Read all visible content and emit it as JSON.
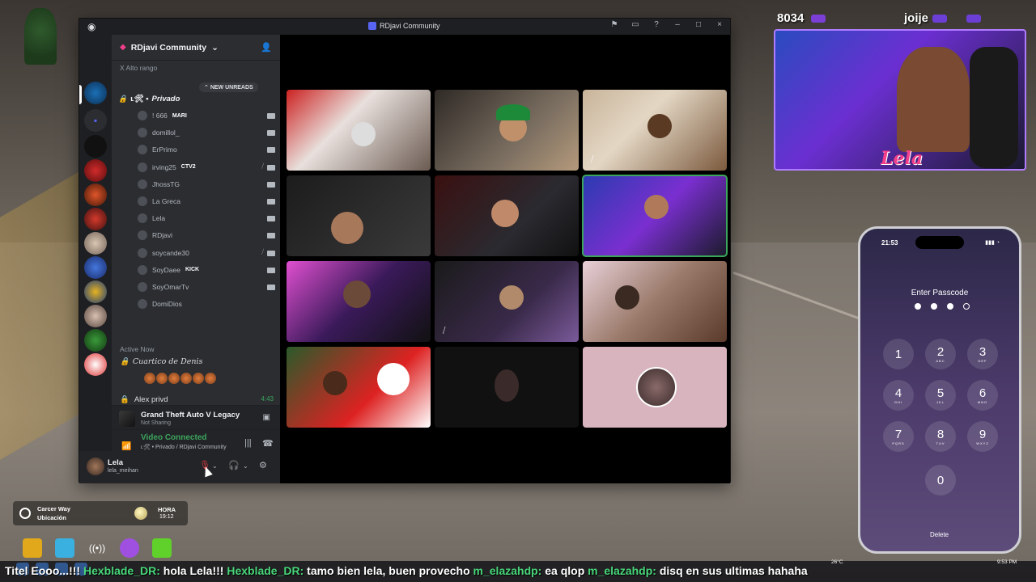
{
  "window": {
    "title": "RDjavi Community"
  },
  "guild": {
    "name": "RDjavi Community"
  },
  "channels": {
    "category_label": "X Alto rango",
    "new_unreads": "NEW UNREADS",
    "voice_channel": "Privado",
    "voice_channel_prefix": "ʟ🛠 •"
  },
  "voice_users": [
    {
      "name": "! 666",
      "badge": "MARI",
      "live": true,
      "muted": false
    },
    {
      "name": "domillol_",
      "badge": "",
      "live": true,
      "muted": false
    },
    {
      "name": "ErPrimo",
      "badge": "",
      "live": true,
      "muted": false
    },
    {
      "name": "irving25",
      "badge": "CTV2",
      "live": true,
      "muted": true
    },
    {
      "name": "JhossTG",
      "badge": "",
      "live": true,
      "muted": false
    },
    {
      "name": "La Greca",
      "badge": "",
      "live": true,
      "muted": false
    },
    {
      "name": "Lela",
      "badge": "",
      "live": true,
      "muted": false
    },
    {
      "name": "RDjavi",
      "badge": "",
      "live": true,
      "muted": false
    },
    {
      "name": "soycande30",
      "badge": "",
      "live": true,
      "muted": true
    },
    {
      "name": "SoyDaee",
      "badge": "KICK",
      "live": true,
      "muted": false
    },
    {
      "name": "SoyOmarTv",
      "badge": "",
      "live": true,
      "muted": false
    },
    {
      "name": "DomiDios",
      "badge": "",
      "live": false,
      "muted": false
    }
  ],
  "active_now": {
    "header": "Active Now",
    "category": "Cuartico de Denis",
    "row_name": "Alex privd",
    "row_time": "4:43"
  },
  "activity": {
    "game": "Grand Theft Auto V Legacy",
    "status": "Not Sharing"
  },
  "voice_status": {
    "title": "Video Connected",
    "subtitle": "ʟ🛠 • Privado / RDjavi Community"
  },
  "user": {
    "name": "Lela",
    "handle": "lela_meihan",
    "mic_muted": true
  },
  "overlay": {
    "viewer_count": "8034",
    "streamer_name": "joije",
    "cam_name": "Lela"
  },
  "phone": {
    "time": "21:53",
    "title": "Enter Passcode",
    "filled_digits": 3,
    "total_digits": 4,
    "keys": [
      {
        "num": "1",
        "sub": ""
      },
      {
        "num": "2",
        "sub": "ABC"
      },
      {
        "num": "3",
        "sub": "DEF"
      },
      {
        "num": "4",
        "sub": "GHI"
      },
      {
        "num": "5",
        "sub": "JKL"
      },
      {
        "num": "6",
        "sub": "MNO"
      },
      {
        "num": "7",
        "sub": "PQRS"
      },
      {
        "num": "8",
        "sub": "TUV"
      },
      {
        "num": "9",
        "sub": "WXYZ"
      },
      {
        "num": "0",
        "sub": ""
      }
    ],
    "delete": "Delete"
  },
  "hud": {
    "street": "Carcer Way",
    "area": "Ubicación",
    "hora_label": "HORA",
    "hora_value": "19:12"
  },
  "chat": {
    "line_prefix": "Titel Eooo...!!!",
    "user1": "Hexblade_DR:",
    "msg1": "hola Lela!!!",
    "user2": "Hexblade_DR:",
    "msg2": "tamo bien lela, buen provecho",
    "user3": "m_elazahdp:",
    "msg3": "ea qlop",
    "user4": "m_elazahdp:",
    "msg4": "disq en sus ultimas hahaha"
  },
  "tray": {
    "temp": "26°C",
    "time": "9:53 PM"
  },
  "colors": {
    "green": "#3ba55c",
    "blurple": "#5865f2",
    "red": "#f23f43"
  }
}
